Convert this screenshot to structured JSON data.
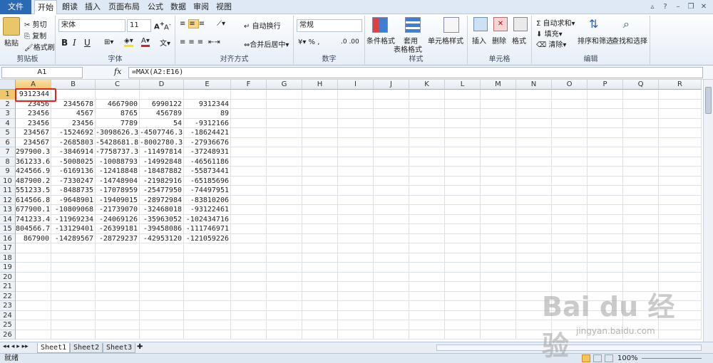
{
  "tabs": {
    "file": "文件",
    "items": [
      "开始",
      "朗读",
      "插入",
      "页面布局",
      "公式",
      "数据",
      "审阅",
      "视图"
    ]
  },
  "ribbon": {
    "clipboard": {
      "paste": "粘贴",
      "cut": "剪切",
      "copy": "复制",
      "format_painter": "格式刷",
      "label": "剪贴板"
    },
    "font": {
      "name": "宋体",
      "size": "11",
      "bold": "B",
      "italic": "I",
      "underline": "U",
      "label": "字体"
    },
    "align": {
      "wrap": "自动换行",
      "merge": "合并后居中",
      "label": "对齐方式"
    },
    "number": {
      "format": "常规",
      "label": "数字"
    },
    "styles": {
      "cond": "条件格式",
      "table": "套用",
      "table2": "表格格式",
      "cell": "单元格样式",
      "label": "样式"
    },
    "cells": {
      "insert": "插入",
      "delete": "删除",
      "format": "格式",
      "label": "单元格"
    },
    "edit": {
      "autosum": "自动求和",
      "fill": "填充",
      "clear": "清除",
      "sort": "排序和筛选",
      "find": "查找和选择",
      "label": "编辑"
    }
  },
  "formula_bar": {
    "name_box": "A1",
    "fx": "fx",
    "formula": "=MAX(A2:E16)"
  },
  "columns": [
    "A",
    "B",
    "C",
    "D",
    "E",
    "F",
    "G",
    "H",
    "I",
    "J",
    "K",
    "L",
    "M",
    "N",
    "O",
    "P",
    "Q",
    "R"
  ],
  "rows": [
    [
      "9312344",
      "",
      "",
      "",
      ""
    ],
    [
      "23456",
      "2345678",
      "4667900",
      "6990122",
      "9312344"
    ],
    [
      "23456",
      "4567",
      "8765",
      "456789",
      "89"
    ],
    [
      "23456",
      "23456",
      "7789",
      "54",
      "-9312166"
    ],
    [
      "234567",
      "-1524692",
      "-3098626.3",
      "-4507746.3",
      "-18624421"
    ],
    [
      "234567",
      "-2685803",
      "-5428681.8",
      "-8002780.3",
      "-27936676"
    ],
    [
      "297900.3",
      "-3846914",
      "-7758737.3",
      "-11497814",
      "-37248931"
    ],
    [
      "361233.6",
      "-5008025",
      "-10088793",
      "-14992848",
      "-46561186"
    ],
    [
      "424566.9",
      "-6169136",
      "-12418848",
      "-18487882",
      "-55873441"
    ],
    [
      "487900.2",
      "-7330247",
      "-14748904",
      "-21982916",
      "-65185696"
    ],
    [
      "551233.5",
      "-8488735",
      "-17078959",
      "-25477950",
      "-74497951"
    ],
    [
      "614566.8",
      "-9648901",
      "-19409015",
      "-28972984",
      "-83810206"
    ],
    [
      "677900.1",
      "-10809068",
      "-21739070",
      "-32468018",
      "-93122461"
    ],
    [
      "741233.4",
      "-11969234",
      "-24069126",
      "-35963052",
      "-102434716"
    ],
    [
      "804566.7",
      "-13129401",
      "-26399181",
      "-39458086",
      "-111746971"
    ],
    [
      "867900",
      "-14289567",
      "-28729237",
      "-42953120",
      "-121059226"
    ]
  ],
  "row_numbers": [
    "1",
    "2",
    "3",
    "4",
    "5",
    "6",
    "7",
    "8",
    "9",
    "10",
    "11",
    "12",
    "13",
    "14",
    "15",
    "16",
    "17",
    "18",
    "19",
    "20",
    "21",
    "22",
    "23",
    "24",
    "25",
    "26"
  ],
  "sheets": [
    "Sheet1",
    "Sheet2",
    "Sheet3"
  ],
  "status": {
    "ready": "就绪",
    "zoom": "100%"
  },
  "watermark": {
    "logo": "Bai du 经验",
    "url": "jingyan.baidu.com"
  }
}
